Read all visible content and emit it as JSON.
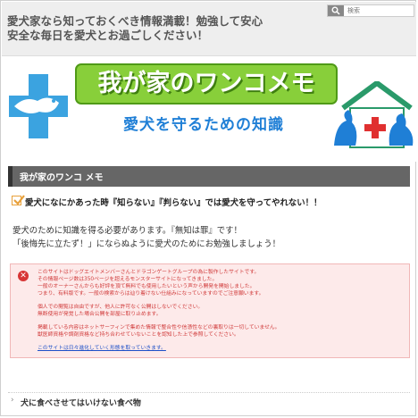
{
  "header": {
    "tagline_line1": "愛犬家なら知っておくべき情報満載！勉強して安心",
    "tagline_line2": "安全な毎日を愛犬とお過ごしください！",
    "search_placeholder": "検索"
  },
  "banner": {
    "title": "我が家のワンコメモ",
    "subtitle": "愛犬を守るための知識",
    "colors": {
      "title_bg": "#88cf3a",
      "subtitle": "#1f7fd6",
      "cross": "#3ba3e0",
      "red_cross": "#e03030",
      "house_roof": "#2a9a6a"
    }
  },
  "page": {
    "title": "我が家のワンコ メモ",
    "lead": "愛犬になにかあった時『知らない』『判らない』では愛犬を守ってやれない！！",
    "body_line1": "愛犬のために知識を得る必要があります。『無知は罪』です！",
    "body_line2": "「後悔先に立たず！」にならぬように愛犬のためにお勉強しましょう！"
  },
  "notice": {
    "icon": "error-x-icon",
    "lines": [
      "このサイトはドッグエイトメンバーさんとドラゴンゲートグループの為に製作したサイトです。",
      "その情報ページ数は350ページを超えるモンスターサイトになってきました。",
      "一般のオーナーさんからも好評を頂て無料でも使用したいという声から開発を開始しました。",
      "つまり、有料版です。一般の検索からは辿り着けない仕組みになっていますのでご注意願います。",
      "",
      "個人での閲覧は自由ですが、他人に許可なく公開はしないでください。",
      "無断使用が発覚した場合公開を部屋に取り止めます。",
      "",
      "掲載している内容はネットサーフィンで集めた情報で整合性や信憑性などの裏取りは一切していません。",
      "獣医師資格や調剤資格など持ち合わせていないことを認知した上で参照してください。"
    ],
    "link": "このサイトは日々進化していく形態を取っていきます。"
  },
  "footer_heading": {
    "label": "犬に食べさせてはいけない食べ物",
    "icon": "chevron-right-icon"
  }
}
